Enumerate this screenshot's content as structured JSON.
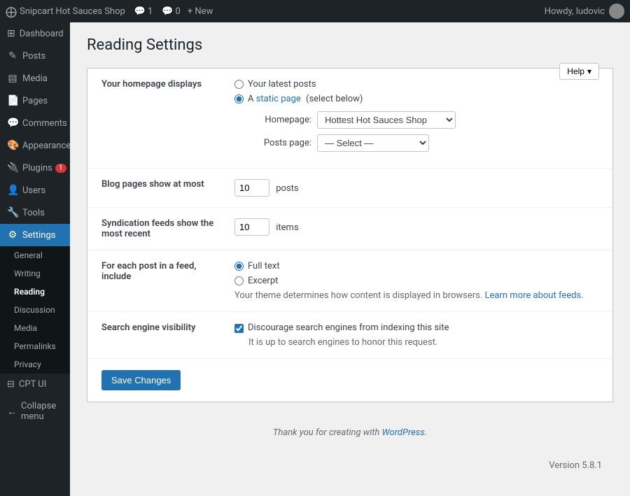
{
  "topbar": {
    "wp_logo": "⊞",
    "site_name": "Snipcart Hot Sauces Shop",
    "comment_count": "1",
    "update_count": "0",
    "new_label": "+ New",
    "howdy_text": "Howdy, ludovic"
  },
  "help_button": {
    "label": "Help",
    "chevron": "▾"
  },
  "sidebar": {
    "items": [
      {
        "id": "dashboard",
        "icon": "⊞",
        "label": "Dashboard"
      },
      {
        "id": "posts",
        "icon": "✎",
        "label": "Posts"
      },
      {
        "id": "media",
        "icon": "🖼",
        "label": "Media"
      },
      {
        "id": "pages",
        "icon": "📄",
        "label": "Pages"
      },
      {
        "id": "comments",
        "icon": "💬",
        "label": "Comments"
      },
      {
        "id": "appearance",
        "icon": "🎨",
        "label": "Appearance"
      },
      {
        "id": "plugins",
        "icon": "🔌",
        "label": "Plugins",
        "badge": "1"
      },
      {
        "id": "users",
        "icon": "👤",
        "label": "Users"
      },
      {
        "id": "tools",
        "icon": "🔧",
        "label": "Tools"
      },
      {
        "id": "settings",
        "icon": "⚙",
        "label": "Settings",
        "active": true
      }
    ],
    "submenu": [
      {
        "id": "general",
        "label": "General"
      },
      {
        "id": "writing",
        "label": "Writing"
      },
      {
        "id": "reading",
        "label": "Reading",
        "active": true
      },
      {
        "id": "discussion",
        "label": "Discussion"
      },
      {
        "id": "media",
        "label": "Media"
      },
      {
        "id": "permalinks",
        "label": "Permalinks"
      },
      {
        "id": "privacy",
        "label": "Privacy"
      }
    ],
    "cpt_ui": {
      "label": "CPT UI",
      "icon": "⊟"
    },
    "collapse": {
      "label": "Collapse menu",
      "icon": "←"
    }
  },
  "page": {
    "title": "Reading Settings"
  },
  "form": {
    "homepage_section": {
      "label": "Your homepage displays",
      "option_latest": "Your latest posts",
      "option_static": "A",
      "static_link_text": "static page",
      "static_suffix": "(select below)",
      "homepage_label": "Homepage:",
      "homepage_value": "Hottest Hot Sauces Shop",
      "posts_page_label": "Posts page:",
      "posts_page_value": "— Select —"
    },
    "blog_pages_section": {
      "label": "Blog pages show at most",
      "value": "10",
      "suffix": "posts"
    },
    "syndication_section": {
      "label": "Syndication feeds show the most recent",
      "value": "10",
      "suffix": "items"
    },
    "feed_section": {
      "label": "For each post in a feed, include",
      "option_full": "Full text",
      "option_excerpt": "Excerpt",
      "note_prefix": "Your theme determines how content is displayed in browsers.",
      "learn_more_text": "Learn more about feeds",
      "note_suffix": "."
    },
    "search_engine_section": {
      "label": "Search engine visibility",
      "checkbox_label": "Discourage search engines from indexing this site",
      "note": "It is up to search engines to honor this request."
    },
    "save_button": "Save Changes"
  },
  "footer": {
    "text": "Thank you for creating with",
    "link_text": "WordPress",
    "text_suffix": ".",
    "version": "Version 5.8.1"
  }
}
